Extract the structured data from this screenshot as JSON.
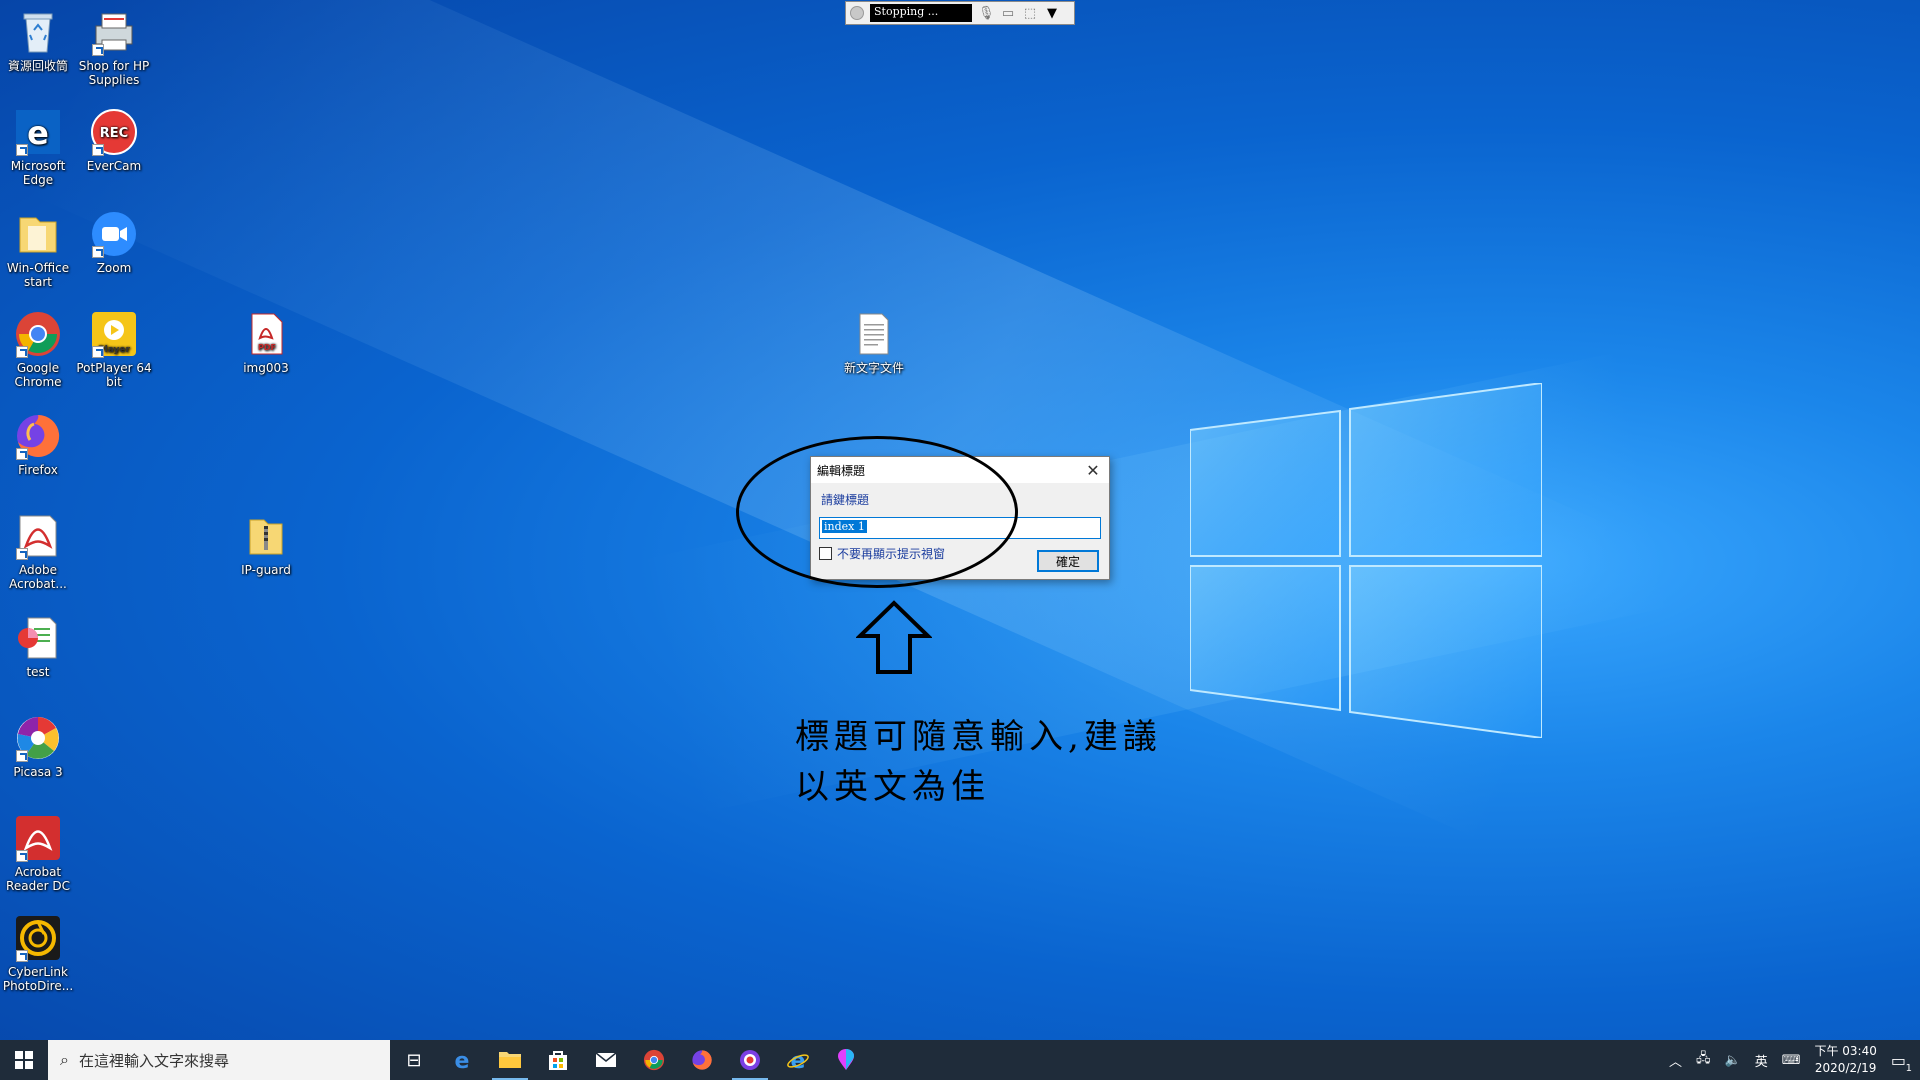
{
  "recorder": {
    "status": "Stopping ..."
  },
  "desktop_icons": [
    {
      "label": "資源回收筒"
    },
    {
      "label": "Shop for HP Supplies"
    },
    {
      "label": "Microsoft Edge"
    },
    {
      "label": "EverCam"
    },
    {
      "label": "Win-Office start"
    },
    {
      "label": "Zoom"
    },
    {
      "label": "Google Chrome"
    },
    {
      "label": "PotPlayer 64 bit"
    },
    {
      "label": "img003"
    },
    {
      "label": "Firefox"
    },
    {
      "label": "Adobe Acrobat..."
    },
    {
      "label": "IP-guard"
    },
    {
      "label": "test"
    },
    {
      "label": "Picasa 3"
    },
    {
      "label": "Acrobat Reader DC"
    },
    {
      "label": "CyberLink PhotoDire..."
    },
    {
      "label": "新文字文件"
    }
  ],
  "dialog": {
    "title": "編輯標題",
    "prompt": "請鍵標題",
    "input_value": "index 1",
    "checkbox_label": "不要再顯示提示視窗",
    "ok_label": "確定"
  },
  "annotation": {
    "line1": "標題可隨意輸入,建議",
    "line2": "以英文為佳"
  },
  "taskbar": {
    "search_placeholder": "在這裡輸入文字來搜尋",
    "ime": "英",
    "time": "下午 03:40",
    "date": "2020/2/19",
    "notification_count": "1"
  },
  "colors": {
    "desktop": "#0a64cf",
    "taskbar": "#1f2c3a",
    "accent": "#0078d7"
  }
}
